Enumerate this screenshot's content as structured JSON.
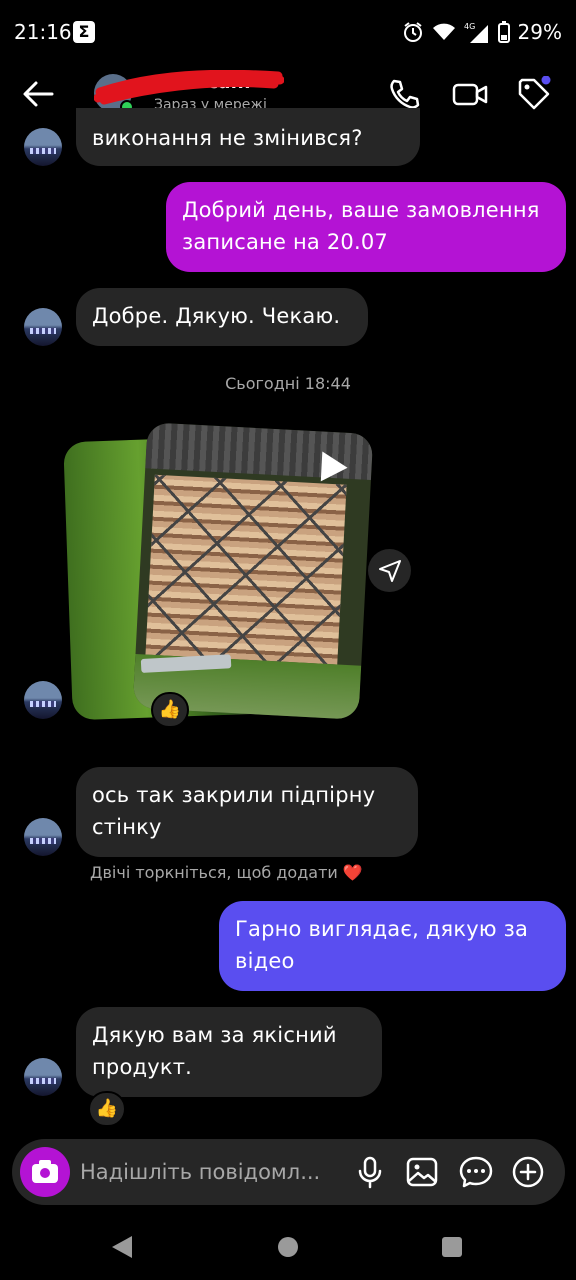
{
  "status_bar": {
    "time": "21:16",
    "notification_glyph": "Σ",
    "battery_percent": "29%",
    "icons": [
      "alarm-icon",
      "wifi-icon",
      "signal-4g-icon",
      "battery-icon"
    ]
  },
  "header": {
    "contact_name": "Алекса...",
    "contact_status": "Зараз у мережі",
    "icons": [
      "back-arrow-icon",
      "phone-icon",
      "video-call-icon",
      "tag-icon"
    ],
    "accent_color": "#5a4ef0"
  },
  "messages": [
    {
      "from": "contact",
      "text": "виконання не змінився?"
    },
    {
      "from": "me",
      "text": "Добрий день, ваше замовлення записане на 20.07"
    },
    {
      "from": "contact",
      "text": "Добре. Дякую. Чекаю."
    },
    {
      "from": "contact",
      "type": "video",
      "reaction": "👍"
    },
    {
      "from": "contact",
      "text": "ось так закрили підпірну стінку"
    },
    {
      "from": "me",
      "text": "Гарно виглядає, дякую за відео"
    },
    {
      "from": "contact",
      "text": "Дякую вам за якісний продукт.",
      "reaction": "👍"
    }
  ],
  "timestamp": "Сьогодні 18:44",
  "hint": "Двічі торкніться, щоб додати ❤️",
  "composer": {
    "placeholder": "Надішліть повідомл...",
    "icons": [
      "camera-icon",
      "microphone-icon",
      "gallery-icon",
      "sticker-chat-icon",
      "plus-circle-icon"
    ]
  },
  "colors": {
    "sent_purple": "#b413d4",
    "sent_blue": "#5a4ef0",
    "received": "#262626",
    "background": "#000000"
  }
}
